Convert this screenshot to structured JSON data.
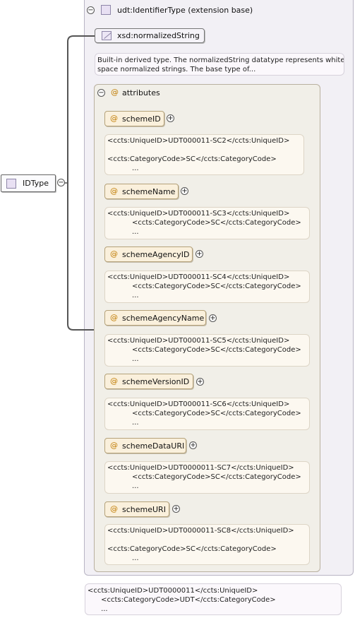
{
  "type_header": {
    "label": "udt:IdentifierType (extension base)"
  },
  "root": {
    "label": "IDType"
  },
  "base_type": {
    "label": "xsd:normalizedString",
    "doc": "Built-in derived type. The normalizedString datatype represents white\nspace normalized strings. The base type of..."
  },
  "attributes_group": {
    "label": "attributes"
  },
  "attributes": [
    {
      "name": "schemeID",
      "doc": "<ccts:UniqueID>UDT000011-SC2</ccts:UniqueID>\n\n<ccts:CategoryCode>SC</ccts:CategoryCode>\n           ..."
    },
    {
      "name": "schemeName",
      "doc": "<ccts:UniqueID>UDT000011-SC3</ccts:UniqueID>\n           <ccts:CategoryCode>SC</ccts:CategoryCode>\n           ..."
    },
    {
      "name": "schemeAgencyID",
      "doc": "<ccts:UniqueID>UDT000011-SC4</ccts:UniqueID>\n           <ccts:CategoryCode>SC</ccts:CategoryCode>\n           ..."
    },
    {
      "name": "schemeAgencyName",
      "doc": "<ccts:UniqueID>UDT000011-SC5</ccts:UniqueID>\n           <ccts:CategoryCode>SC</ccts:CategoryCode>\n           ..."
    },
    {
      "name": "schemeVersionID",
      "doc": "<ccts:UniqueID>UDT000011-SC6</ccts:UniqueID>\n           <ccts:CategoryCode>SC</ccts:CategoryCode>\n           ..."
    },
    {
      "name": "schemeDataURI",
      "doc": "<ccts:UniqueID>UDT0000011-SC7</ccts:UniqueID>\n           <ccts:CategoryCode>SC</ccts:CategoryCode>\n           ..."
    },
    {
      "name": "schemeURI",
      "doc": "<ccts:UniqueID>UDT0000011-SC8</ccts:UniqueID>\n\n<ccts:CategoryCode>SC</ccts:CategoryCode>\n           ..."
    }
  ],
  "root_doc": "<ccts:UniqueID>UDT0000011</ccts:UniqueID>\n      <ccts:CategoryCode>UDT</ccts:CategoryCode>\n      ...",
  "expand_symbol": "+",
  "collapse_symbol": "−",
  "attribute_symbol": "@"
}
